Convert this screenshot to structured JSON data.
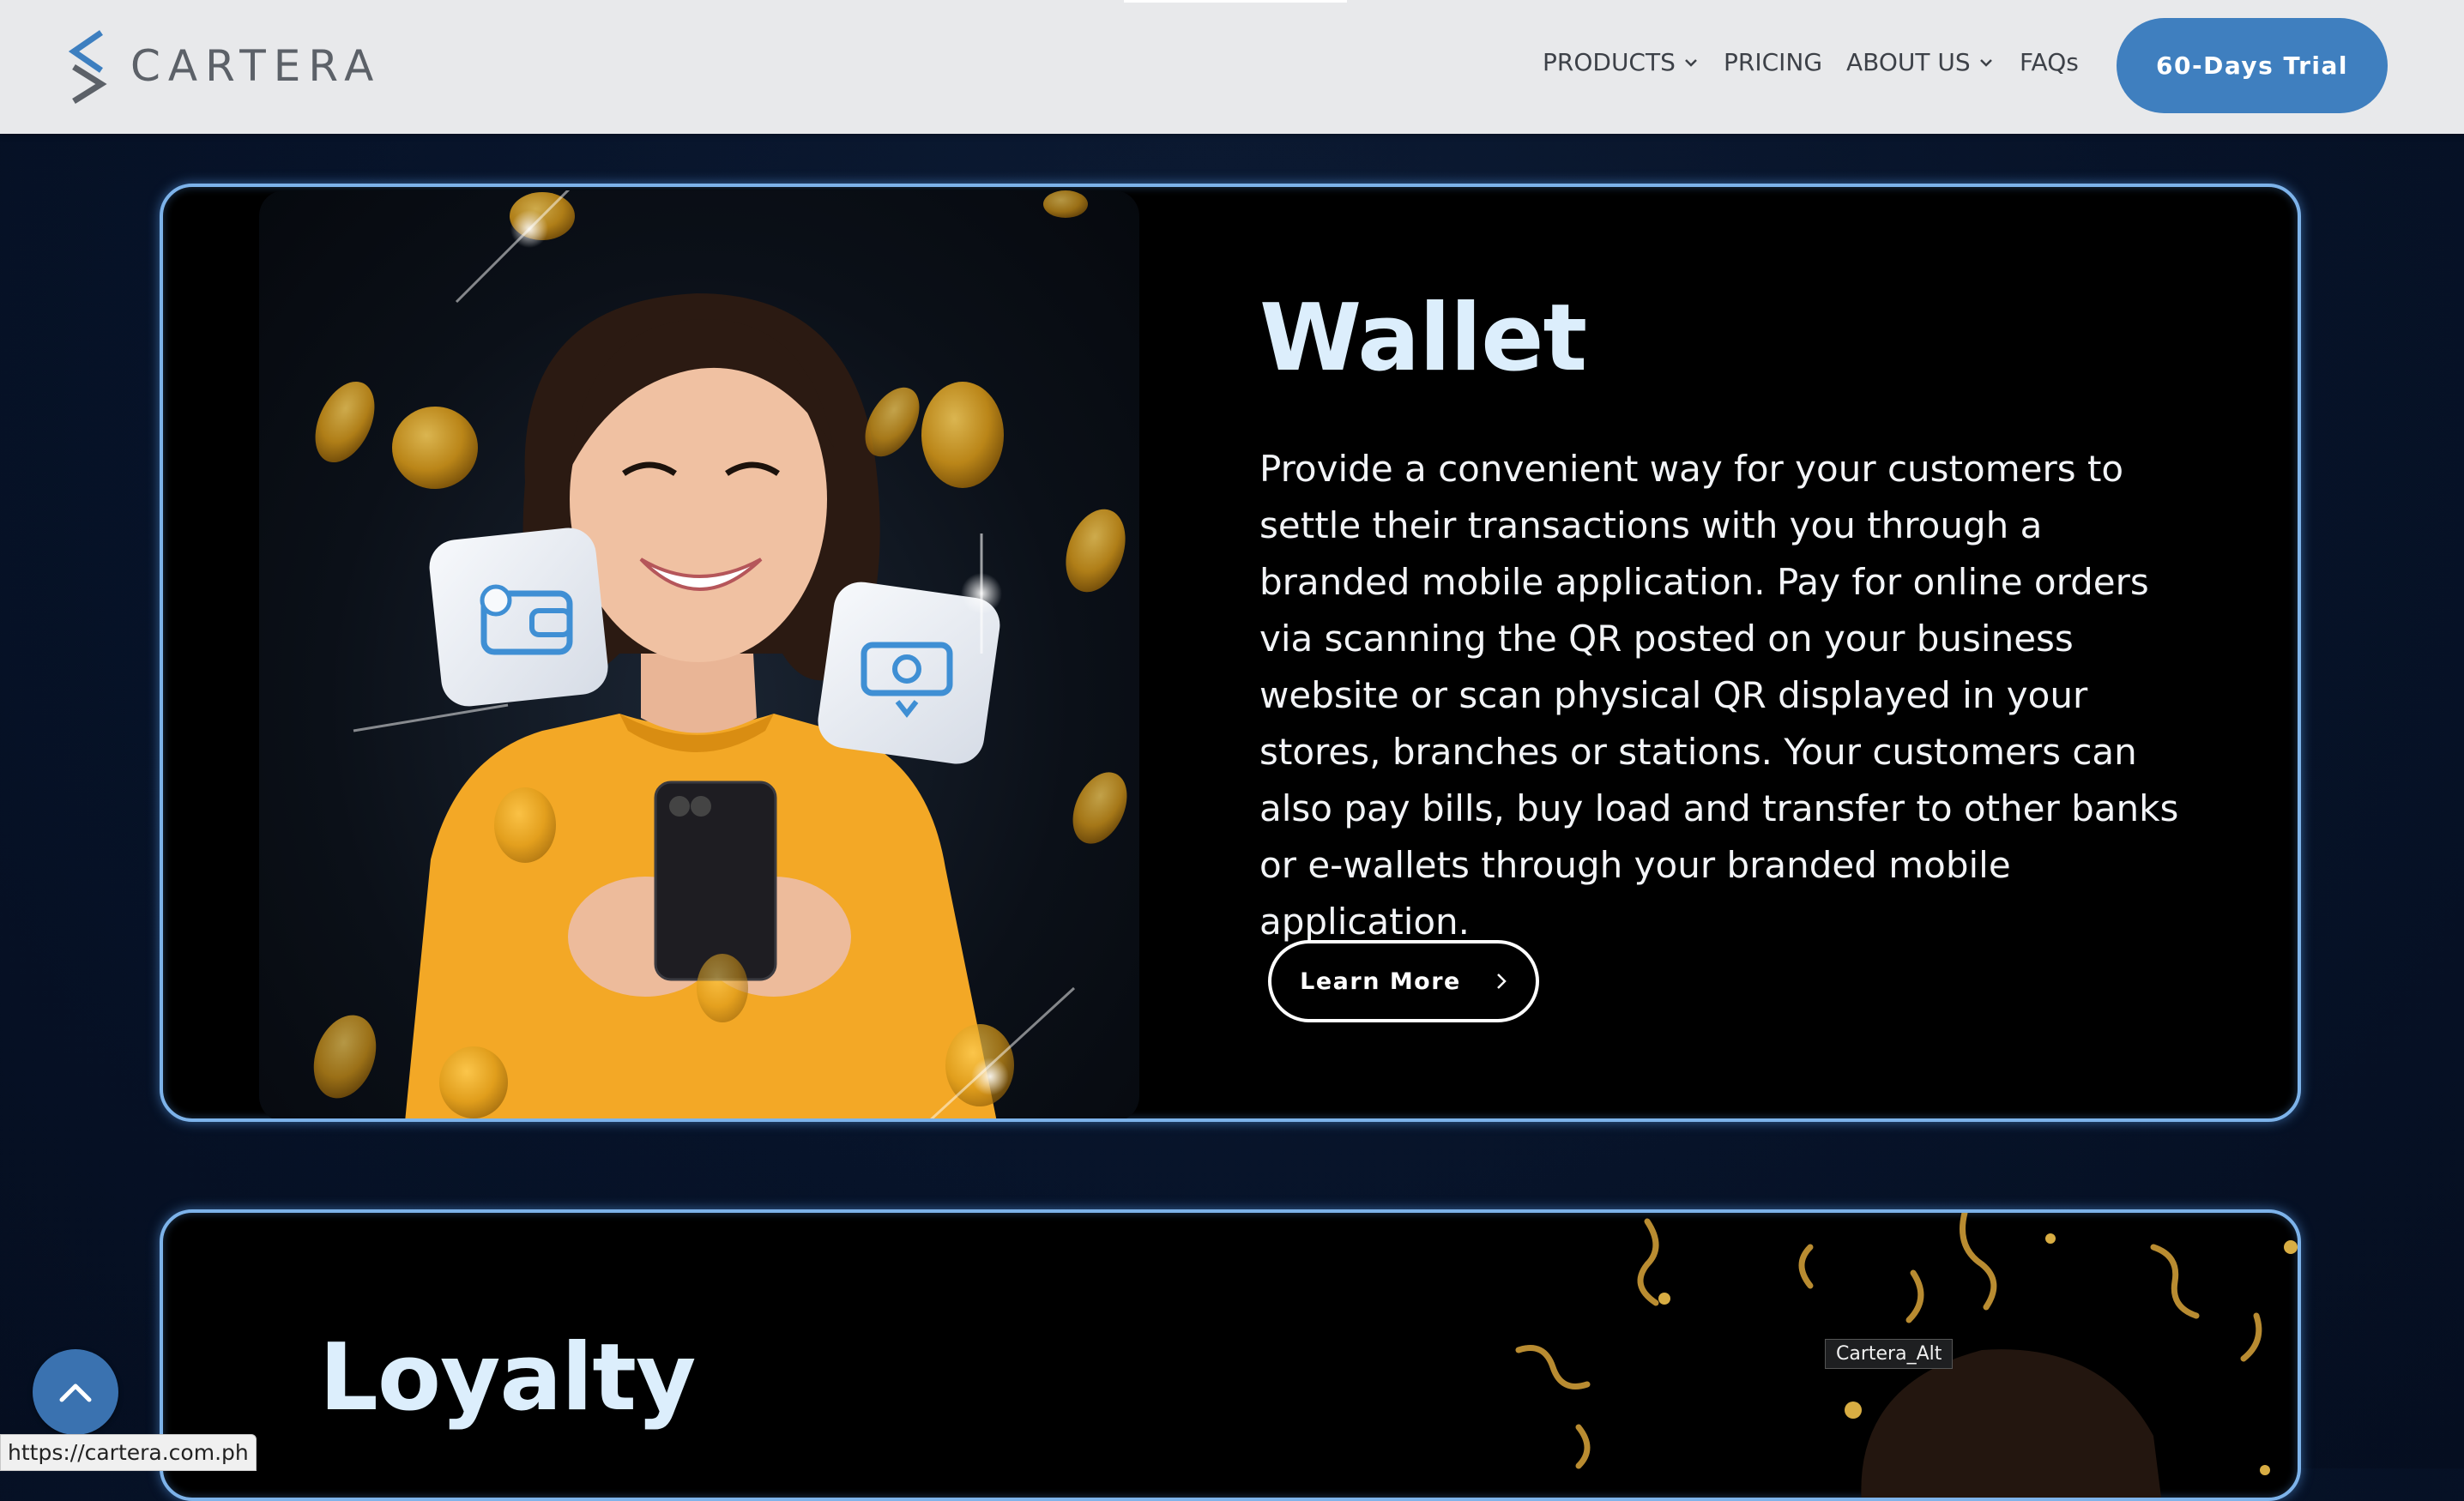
{
  "header": {
    "brand": "CARTERA",
    "nav": [
      {
        "label": "PRODUCTS",
        "dropdown": true
      },
      {
        "label": "PRICING",
        "dropdown": false
      },
      {
        "label": "ABOUT US",
        "dropdown": true
      },
      {
        "label": "FAQs",
        "dropdown": false
      }
    ],
    "cta_label": "60-Days Trial"
  },
  "wallet": {
    "title": "Wallet",
    "description": "Provide a convenient way for your customers to settle their transactions with you through a branded mobile application. Pay for online orders via scanning the QR posted on your business website or scan physical QR displayed in your stores, branches or stations. Your customers can also pay bills, buy load and transfer to other banks or e-wallets through your branded mobile application.",
    "button_label": "Learn More",
    "button_icon": "chevron-right-icon"
  },
  "loyalty": {
    "title": "Loyalty"
  },
  "tooltip": "Cartera_Alt",
  "status_url": "https://cartera.com.ph",
  "colors": {
    "accent": "#3f7fbf",
    "card_border": "#7db3ea",
    "page_bg": "#071329",
    "header_bg": "#e8e9eb"
  }
}
